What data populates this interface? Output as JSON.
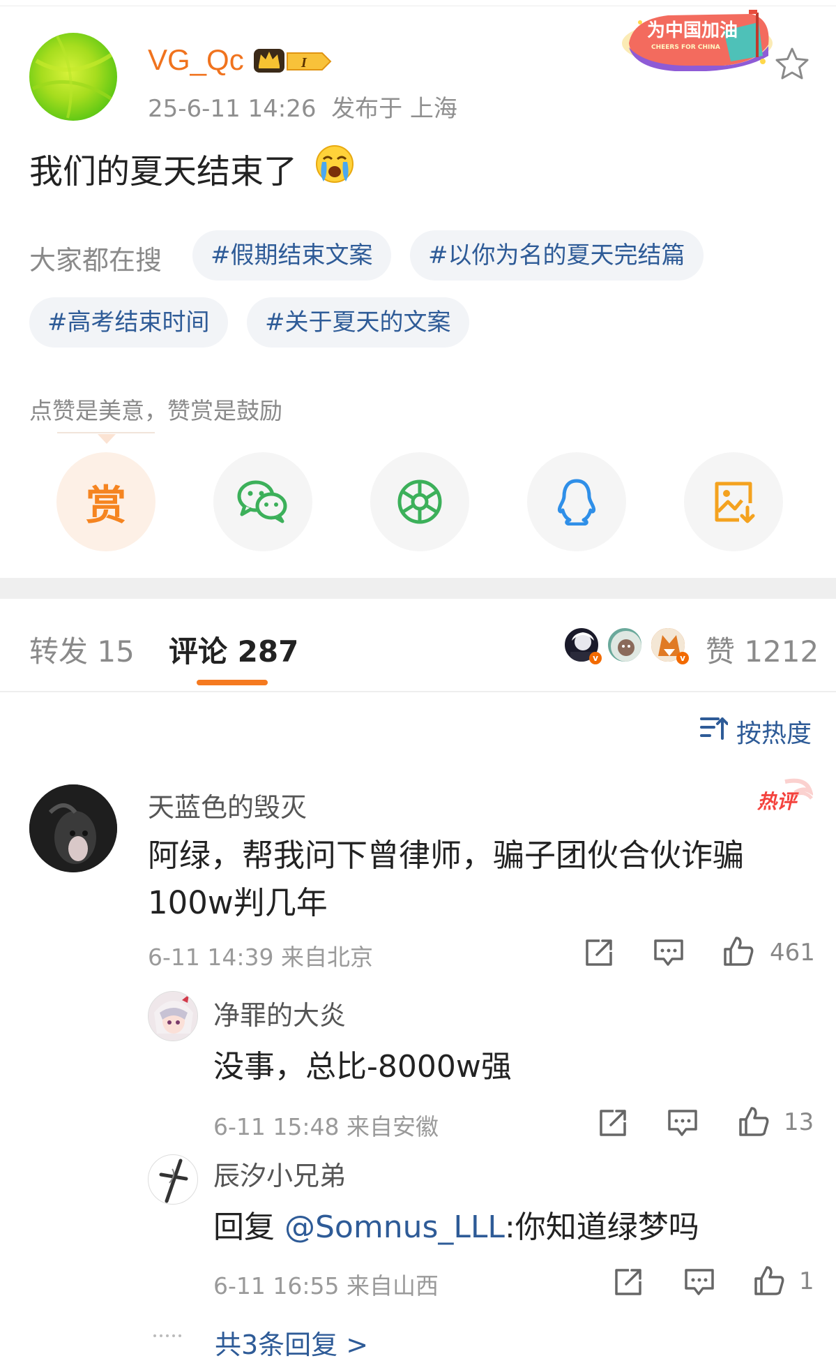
{
  "post": {
    "username": "VG_Qc",
    "vip_level": "I",
    "timestamp": "25-6-11 14:26",
    "location": "发布于 上海",
    "text": "我们的夏天结束了",
    "promo_badge_title": "为中国加油",
    "promo_badge_subtitle": "CHEERS FOR CHINA"
  },
  "hot_search": {
    "label": "大家都在搜",
    "tags": [
      "#假期结束文案",
      "#以你为名的夏天完结篇",
      "#高考结束时间",
      "#关于夏天的文案"
    ]
  },
  "reward_tip": "点赞是美意，赞赏是鼓励",
  "share": {
    "reward_label": "赏",
    "icons": [
      "reward-icon",
      "wechat-icon",
      "moments-icon",
      "qq-icon",
      "save-image-icon"
    ]
  },
  "tabs": {
    "repost": "转发 15",
    "comment": "评论 287",
    "likes": "赞 1212"
  },
  "sort": {
    "label": "按热度"
  },
  "comment": {
    "name": "天蓝色的毁灭",
    "hot_label": "热评",
    "text": "阿绿，帮我问下曾律师，骗子团伙合伙诈骗100w判几年",
    "meta": "6-11 14:39 来自北京",
    "likes": "461",
    "replies": [
      {
        "name": "净罪的大炎",
        "text": "没事，总比-8000w强",
        "meta": "6-11 15:48 来自安徽",
        "likes": "13"
      },
      {
        "name": "辰汐小兄弟",
        "prefix": "回复 ",
        "mention": "@Somnus_LLL",
        "text": ":你知道绿梦吗",
        "meta": "6-11 16:55 来自山西",
        "likes": "1"
      }
    ],
    "more_replies": "共3条回复 >"
  },
  "colors": {
    "username": "#f0731e",
    "link": "#2e5b97",
    "tab_underline": "#f57a20",
    "reward": "#f58420",
    "wechat": "#3cb05a",
    "moments": "#3cb05a",
    "qq": "#2f8fe8",
    "save": "#f4a21f"
  }
}
